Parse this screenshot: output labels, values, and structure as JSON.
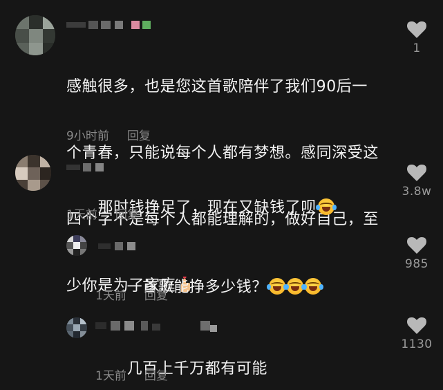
{
  "colors": {
    "background": "#161616",
    "text": "#f2f2f2",
    "meta": "#8a8a8a",
    "like_icon": "#b8b8b8"
  },
  "comments": [
    {
      "text_lines": [
        "感触很多，也是您这首歌陪伴了我们90后一",
        "个青春，只能说每个人都有梦想。感同深受这",
        "四个字不是每个人都能理解的，做好自己，至",
        "少你是为了家庭"
      ],
      "time": "9小时前",
      "reply_label": "回复",
      "likes": "1",
      "trailing_icon": "heart-hand-icon"
    },
    {
      "text_lines": [
        "那时钱挣足了，现在又缺钱了呗"
      ],
      "time": "1天前",
      "reply_label": "回复",
      "likes": "3.8w",
      "trailing_icon": "laugh-cry-emoji"
    },
    {
      "text_lines": [
        "一首歌能挣多少钱？"
      ],
      "time": "1天前",
      "reply_label": "回复",
      "likes": "985",
      "trailing_icon": "laugh-cry-emoji"
    },
    {
      "text_lines": [
        "几百上千万都有可能"
      ],
      "time": "1天前",
      "reply_label": "回复",
      "likes": "1130"
    }
  ]
}
